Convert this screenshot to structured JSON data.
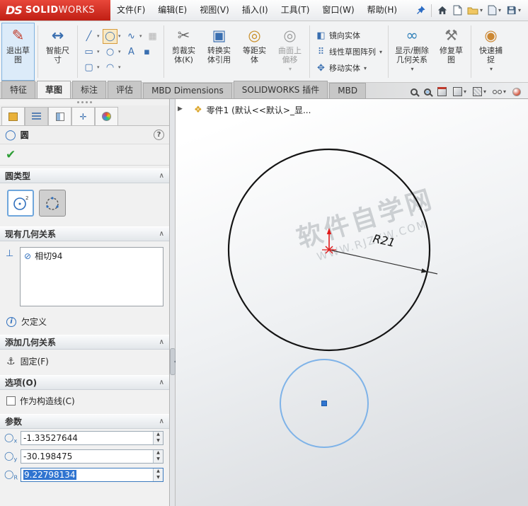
{
  "titlebar": {
    "logo_mark": "DS",
    "logo_solid": "SOLID",
    "logo_works": "WORKS",
    "menus": [
      "文件(F)",
      "编辑(E)",
      "视图(V)",
      "插入(I)",
      "工具(T)",
      "窗口(W)",
      "帮助(H)"
    ]
  },
  "ribbon": {
    "exit_sketch": "退出草图",
    "smart_dimension": "智能尺寸",
    "trim": "剪裁实体(K)",
    "convert": "转换实体引用",
    "offset": "等距实体",
    "surface_offset": "曲面上偏移",
    "mirror": "镜向实体",
    "linear_pattern": "线性草图阵列",
    "move": "移动实体",
    "display_relations": "显示/删除几何关系",
    "repair": "修复草图",
    "quick_snaps": "快速捕捉"
  },
  "tabs": [
    "特征",
    "草图",
    "标注",
    "评估",
    "MBD Dimensions",
    "SOLIDWORKS 插件",
    "MBD"
  ],
  "active_tab": "草图",
  "panel": {
    "title": "圆",
    "circle_type_header": "圆类型",
    "existing_relations_header": "现有几何关系",
    "relation_item": "相切94",
    "status": "欠定义",
    "add_relations_header": "添加几何关系",
    "fix_label": "固定(F)",
    "options_header": "选项(O)",
    "construction_label": "作为构造线(C)",
    "parameters_header": "参数",
    "params": [
      {
        "axis": "x",
        "value": "-1.33527644"
      },
      {
        "axis": "y",
        "value": "-30.198475"
      },
      {
        "axis": "R",
        "value": "9.22798134"
      }
    ]
  },
  "viewport": {
    "breadcrumb": "零件1 (默认<<默认>_显...",
    "dimension": "R21",
    "watermark1": "软件自学网",
    "watermark2": "WWW.RJZXW.COM"
  },
  "colors": {
    "accent_blue": "#2f74d0",
    "selection_circle": "#7fb3e8",
    "origin_red": "#e01b1b",
    "logo_red": "#d3291d"
  },
  "icons": {
    "dropdown": "▾",
    "collapse": "∧",
    "flyout": "▶",
    "check": "✔",
    "help": "?",
    "info": "i",
    "line": "╱",
    "circle": "◯",
    "spline": "∿",
    "pattern": "▦",
    "rect": "▭",
    "ellipse": "○",
    "text_tool": "A",
    "point": "▪",
    "slot": "▢",
    "arc": "◠",
    "exit": "✎",
    "smartdim": "↔",
    "trim": "✂",
    "convert": "▣",
    "offset": "◎",
    "surface_offset": "◎",
    "mirror": "◧",
    "linear_pattern": "⠿",
    "move": "✥",
    "relations": "∞",
    "repair": "⚒",
    "quick_snaps": "◉",
    "tangent": "⊘",
    "perp": "⊥",
    "fix": "⚓",
    "circle_glyph": "◯",
    "spin_up": "▲",
    "spin_down": "▼",
    "cross": "✛"
  }
}
